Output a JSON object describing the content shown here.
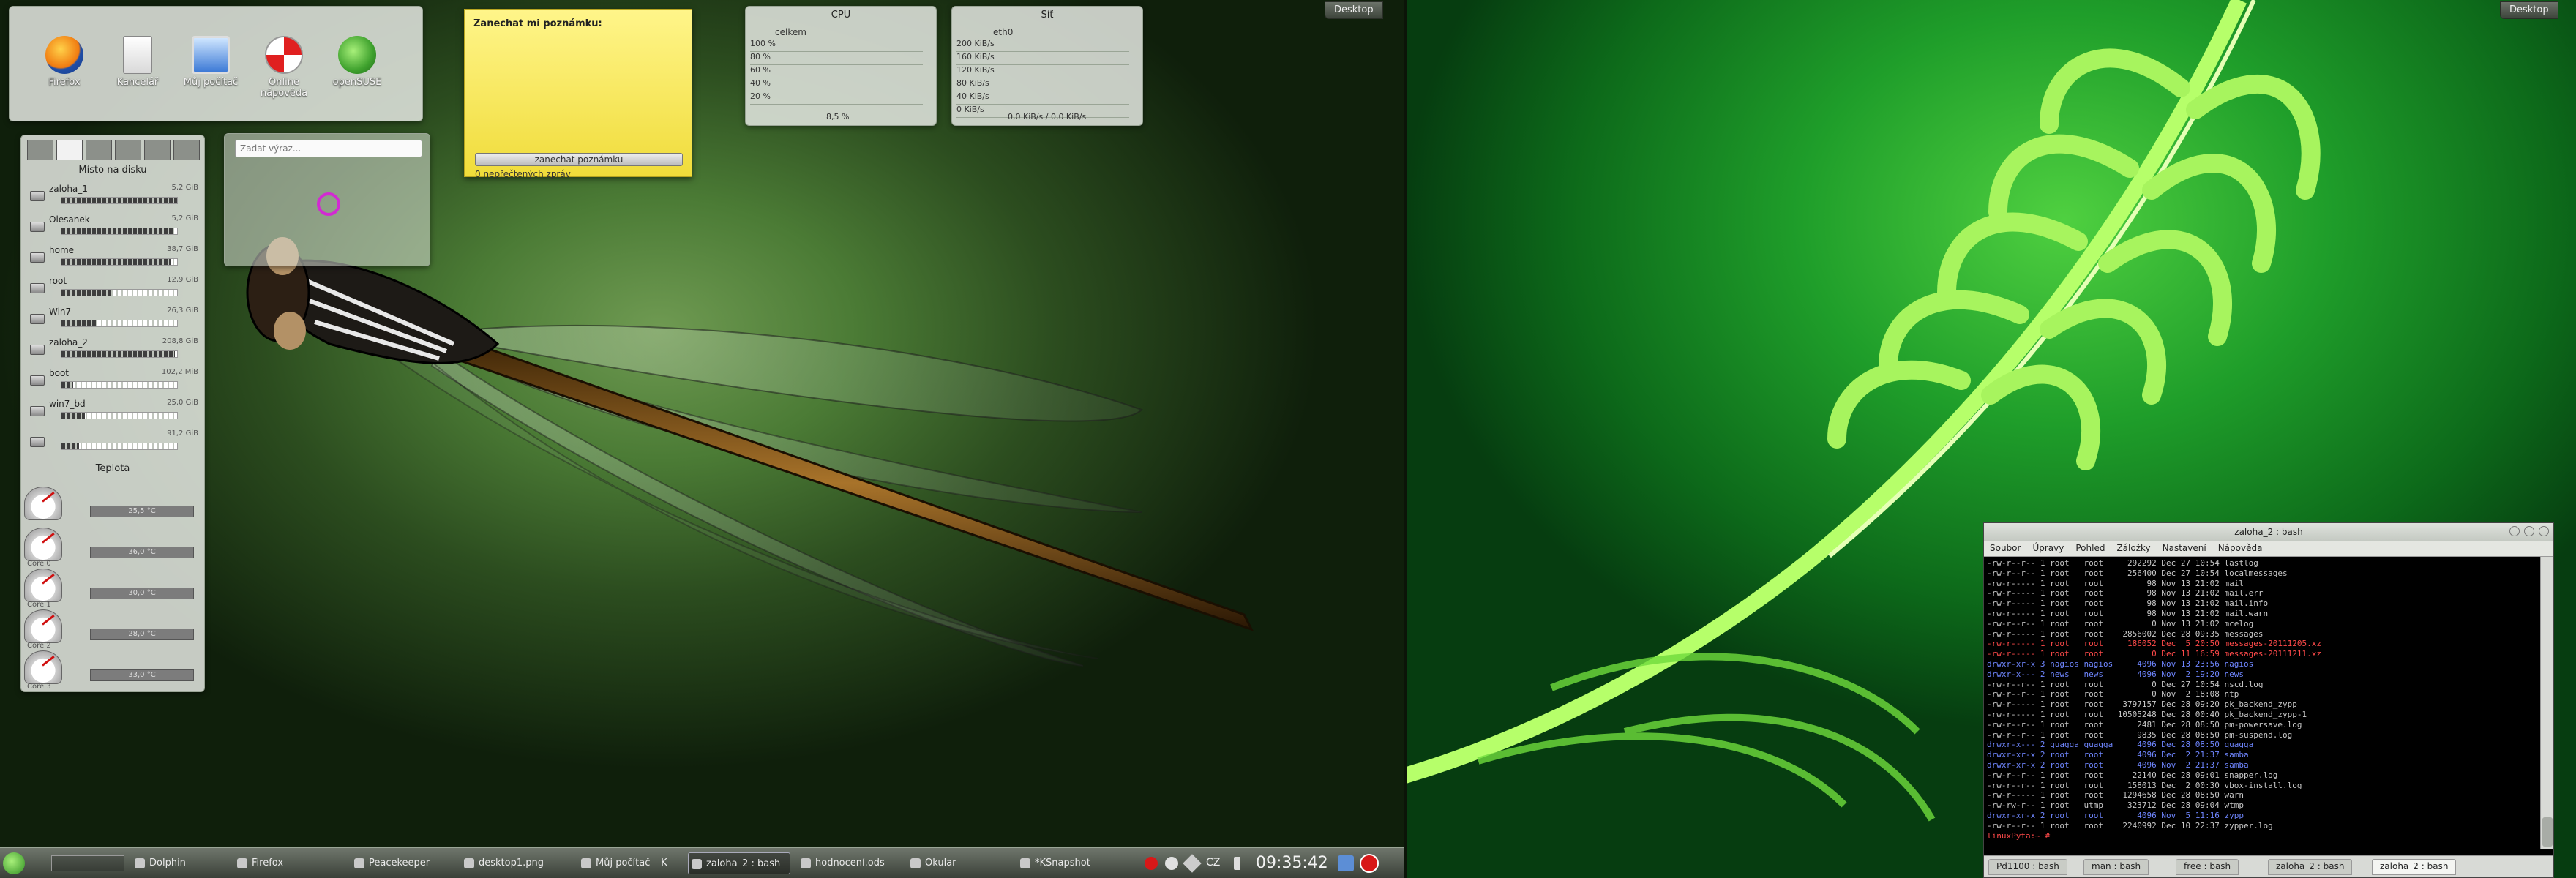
{
  "desktop_buttons": {
    "left": "Desktop",
    "right": "Desktop"
  },
  "desktop_icons": [
    {
      "label": "Firefox",
      "icon": "firefox-icon"
    },
    {
      "label": "Kancelář",
      "icon": "office-document-icon"
    },
    {
      "label": "Můj počítač",
      "icon": "computer-icon"
    },
    {
      "label": "Online nápověda",
      "icon": "help-lifebuoy-icon"
    },
    {
      "label": "openSUSE",
      "icon": "opensuse-gecko-icon"
    }
  ],
  "notes": {
    "title": "Zanechat mi poznámku:",
    "button": "zanechat poznámku",
    "status": "0 nepřečtených zpráv"
  },
  "search": {
    "placeholder": "Zadat výraz..."
  },
  "disk": {
    "title": "Místo na disku",
    "rows": [
      {
        "name": "zaloha_1",
        "val": "5,2 GiB",
        "fill": 1.0
      },
      {
        "name": "Olesanek",
        "val": "5,2 GiB",
        "fill": 0.97
      },
      {
        "name": "home",
        "val": "38,7 GiB",
        "fill": 0.95
      },
      {
        "name": "root",
        "val": "12,9 GiB",
        "fill": 0.45
      },
      {
        "name": "Win7",
        "val": "26,3 GiB",
        "fill": 0.3
      },
      {
        "name": "zaloha_2",
        "val": "208,8 GiB",
        "fill": 0.98
      },
      {
        "name": "boot",
        "val": "102,2 MiB",
        "fill": 0.1
      },
      {
        "name": "win7_bd",
        "val": "25,0 GiB",
        "fill": 0.2
      },
      {
        "name": "",
        "val": "91,2 GiB",
        "fill": 0.15
      }
    ]
  },
  "temps": {
    "title": "Teplota",
    "rows": [
      {
        "name": "",
        "val": "25,5 °C"
      },
      {
        "name": "Core 0",
        "val": "36,0 °C"
      },
      {
        "name": "Core 1",
        "val": "30,0 °C"
      },
      {
        "name": "Core 2",
        "val": "28,0 °C"
      },
      {
        "name": "Core 3",
        "val": "33,0 °C"
      }
    ]
  },
  "cpu": {
    "title": "CPU",
    "sub": "celkem",
    "lines": [
      "100 %",
      "80 %",
      "60 %",
      "40 %",
      "20 %"
    ],
    "readout": "8,5 %"
  },
  "net": {
    "title": "Síť",
    "sub": "eth0",
    "lines": [
      "200 KiB/s",
      "160 KiB/s",
      "120 KiB/s",
      "80 KiB/s",
      "40 KiB/s",
      "0 KiB/s"
    ],
    "readout": "0,0 KiB/s / 0,0 KiB/s"
  },
  "terminal": {
    "title": "zaloha_2 : bash",
    "menu": [
      "Soubor",
      "Úpravy",
      "Pohled",
      "Záložky",
      "Nastavení",
      "Nápověda"
    ],
    "lines": [
      "-rw-r--r-- 1 root   root     292292 Dec 27 10:54 lastlog",
      "-rw-r--r-- 1 root   root     256400 Dec 27 10:54 localmessages",
      "-rw-r----- 1 root   root         98 Nov 13 21:02 mail",
      "-rw-r----- 1 root   root         98 Nov 13 21:02 mail.err",
      "-rw-r----- 1 root   root         98 Nov 13 21:02 mail.info",
      "-rw-r----- 1 root   root         98 Nov 13 21:02 mail.warn",
      "-rw-r--r-- 1 root   root          0 Nov 13 21:02 mcelog",
      "-rw-r----- 1 root   root    2856002 Dec 28 09:35 messages",
      "-rw-r----- 1 root   root     186052 Dec  5 20:50 messages-20111205.xz",
      "-rw-r----- 1 root   root          0 Dec 11 16:59 messages-20111211.xz",
      "drwxr-xr-x 3 nagios nagios     4096 Nov 13 23:56 nagios",
      "drwxr-x--- 2 news   news       4096 Nov  2 19:20 news",
      "-rw-r--r-- 1 root   root          0 Dec 27 10:54 nscd.log",
      "-rw-r--r-- 1 root   root          0 Nov  2 18:08 ntp",
      "-rw-r----- 1 root   root    3797157 Dec 28 09:20 pk_backend_zypp",
      "-rw-r----- 1 root   root   10505248 Dec 28 00:40 pk_backend_zypp-1",
      "-rw-r--r-- 1 root   root       2481 Dec 28 08:50 pm-powersave.log",
      "-rw-r--r-- 1 root   root       9835 Dec 28 08:50 pm-suspend.log",
      "drwxr-x--- 2 quagga quagga     4096 Dec 28 08:50 quagga",
      "drwxr-xr-x 2 root   root       4096 Dec  2 21:37 samba",
      "drwxr-xr-x 2 root   root       4096 Nov  2 21:37 samba",
      "-rw-r--r-- 1 root   root      22140 Dec 28 09:01 snapper.log",
      "-rw-r--r-- 1 root   root     158013 Dec  2 00:30 vbox-install.log",
      "-rw-r----- 1 root   root    1294658 Dec 28 08:50 warn",
      "-rw-rw-r-- 1 root   utmp     323712 Dec 28 09:04 wtmp",
      "drwxr-xr-x 2 root   root       4096 Nov  5 11:16 zypp",
      "-rw-r--r-- 1 root   root    2240992 Dec 10 22:37 zypper.log",
      "linuxPyta:~ #"
    ],
    "tabs": [
      "Pd1100 : bash",
      "man : bash",
      "free : bash",
      "zaloha_2 : bash",
      "zaloha_2 : bash"
    ]
  },
  "taskbar": {
    "items": [
      "Dolphin",
      "Firefox",
      "Peacekeeper",
      "desktop1.png",
      "Můj počítač – K",
      "zaloha_2 : bash",
      "hodnocení.ods",
      "Okular",
      "*KSnapshot"
    ],
    "layout": "CZ",
    "clock": "09:35:42"
  }
}
